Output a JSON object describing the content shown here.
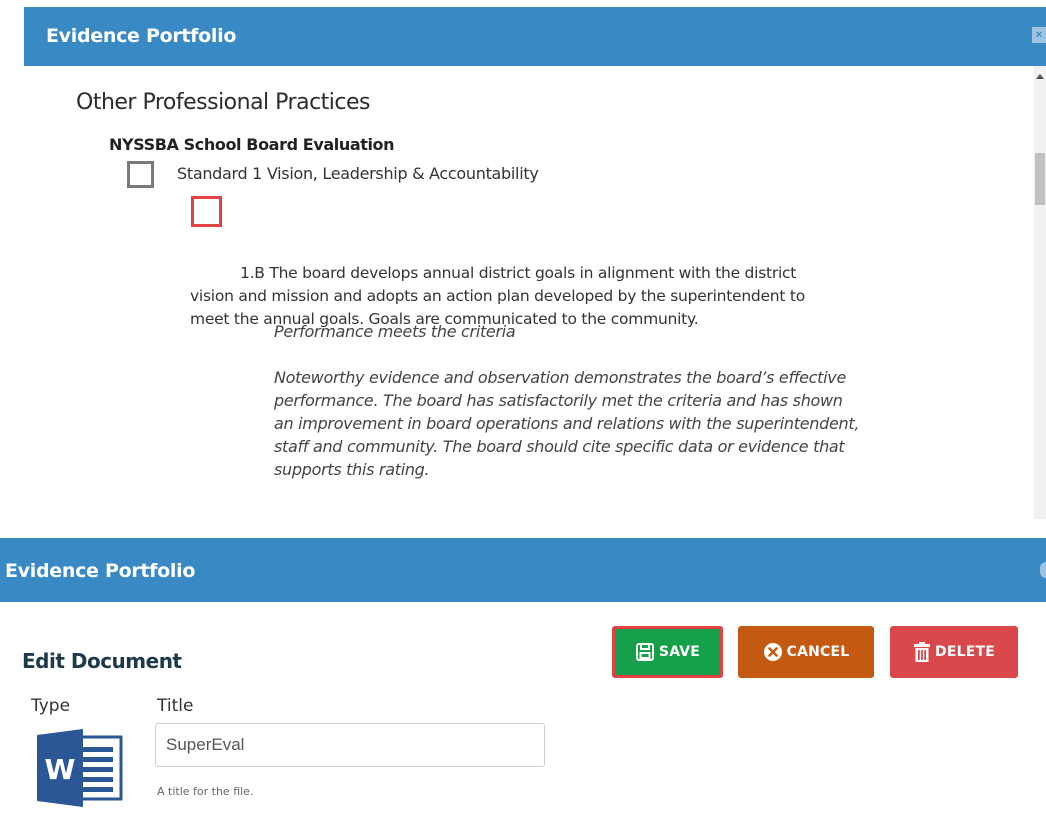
{
  "top_panel": {
    "window_title": "Evidence Portfolio",
    "close_glyph": "×",
    "section_heading": "Other Professional Practices",
    "subsection_heading": "NYSSBA School Board Evaluation",
    "standard_label": "Standard 1 Vision, Leadership & Accountability",
    "item_text": "1.B The board develops annual district goals in alignment with the district vision and mission and adopts an action plan developed by the superintendent to meet the annual goals. Goals are communicated to the community.",
    "rating_title": "Performance meets the criteria",
    "rating_description": "Noteworthy evidence and observation demonstrates the board’s effective performance. The board has satisfactorily met the criteria and has shown an improvement in board operations and relations with the superintendent, staff and community. The board should cite specific data or evidence that supports this rating."
  },
  "bottom_panel": {
    "window_title": "Evidence Portfolio",
    "heading": "Edit Document",
    "buttons": {
      "save": "SAVE",
      "cancel": "CANCEL",
      "delete": "DELETE"
    },
    "type_label": "Type",
    "title_label": "Title",
    "title_value": "SuperEval",
    "title_helper": "A title for the file.",
    "file_type_icon": "word-document-icon"
  },
  "colors": {
    "titlebar": "#3889c4",
    "save": "#16a04a",
    "cancel": "#c45a12",
    "delete": "#d9484b",
    "highlight": "#e04343"
  }
}
